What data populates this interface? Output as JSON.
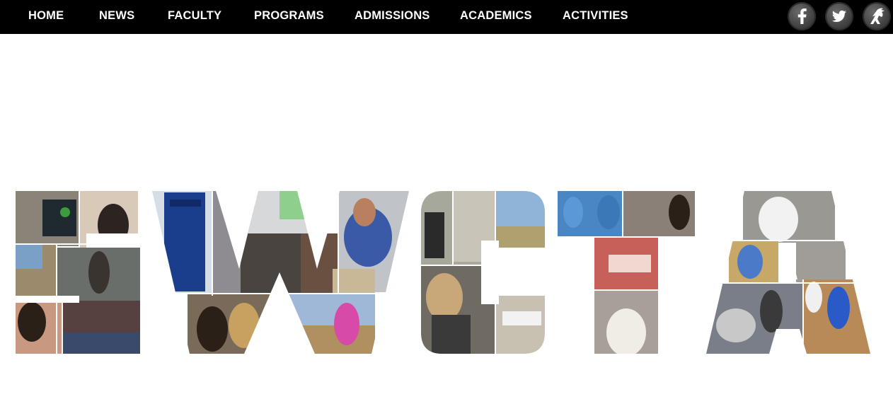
{
  "nav": {
    "items": [
      {
        "label": "HOME"
      },
      {
        "label": "NEWS"
      },
      {
        "label": "FACULTY"
      },
      {
        "label": "PROGRAMS"
      },
      {
        "label": "ADMISSIONS"
      },
      {
        "label": "ACADEMICS"
      },
      {
        "label": "ACTIVITIES"
      }
    ],
    "social": [
      {
        "icon": "facebook-icon"
      },
      {
        "icon": "twitter-icon"
      },
      {
        "icon": "roadrunner-icon"
      }
    ]
  },
  "hero": {
    "wordmark": "SWCTA",
    "style": "photo-collage block letters"
  },
  "colors": {
    "nav_bg": "#000000",
    "nav_text": "#ffffff",
    "page_bg": "#ffffff"
  }
}
